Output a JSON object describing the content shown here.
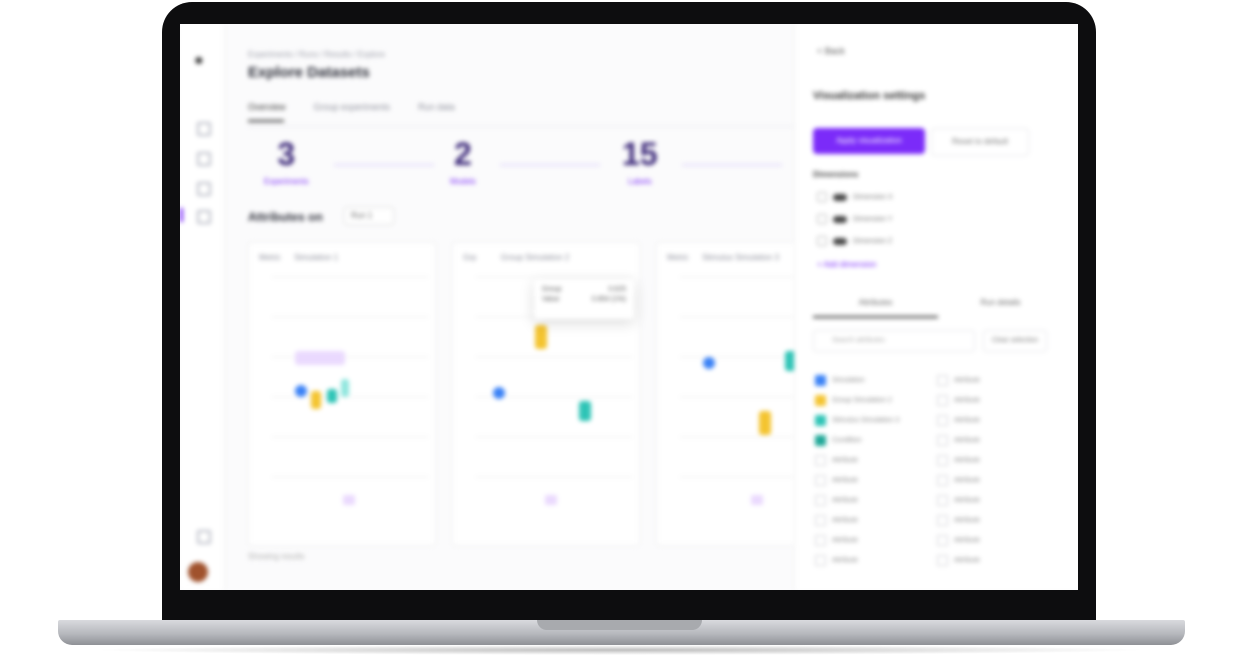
{
  "breadcrumb": [
    "Experiments",
    "Runs",
    "Results",
    "Explore"
  ],
  "page_title": "Explore Datasets",
  "tabs": [
    "Overview",
    "Group experiments",
    "Run data"
  ],
  "stats": [
    {
      "value": "3",
      "label": "Experiments"
    },
    {
      "value": "2",
      "label": "Models"
    },
    {
      "value": "15",
      "label": "Labels"
    }
  ],
  "section_title": "Attributes on",
  "filter_value": "Run 1",
  "cards": [
    {
      "left_label": "Metric",
      "right_label": "Simulation 1"
    },
    {
      "left_label": "Grp",
      "right_label": "Group Simulation 2"
    },
    {
      "left_label": "Metric",
      "right_label": "Stimulus Simulation 3"
    }
  ],
  "tooltip": {
    "row1_key": "Group",
    "row1_val": "0.625",
    "row2_key": "Value",
    "row2_val": "0.854 (1%)"
  },
  "bottom_note": "Showing results",
  "panel": {
    "back": "< Back",
    "title": "Visualization settings",
    "primary_button": "Apply visualization",
    "secondary_button": "Reset to default",
    "dimensions_label": "Dimensions",
    "dimensions": [
      "Dimension X",
      "Dimension Y",
      "Dimension Z"
    ],
    "add_link": "+ Add dimension",
    "tabs": [
      "Attributes",
      "Run details"
    ],
    "search_placeholder": "Search attributes",
    "clear_button": "Clear selection",
    "left_list": [
      "Simulation",
      "Group Simulation 2",
      "Stimulus Simulation 3",
      "Condition",
      "Attribute",
      "Attribute",
      "Attribute",
      "Attribute",
      "Attribute",
      "Attribute"
    ],
    "right_list": [
      "Attribute",
      "Attribute",
      "Attribute",
      "Attribute",
      "Attribute",
      "Attribute",
      "Attribute",
      "Attribute",
      "Attribute",
      "Attribute"
    ]
  },
  "colors": {
    "accent": "#7b2bf9",
    "blue": "#3b82f6",
    "yellow": "#f4c430",
    "teal": "#2ec4b6"
  }
}
